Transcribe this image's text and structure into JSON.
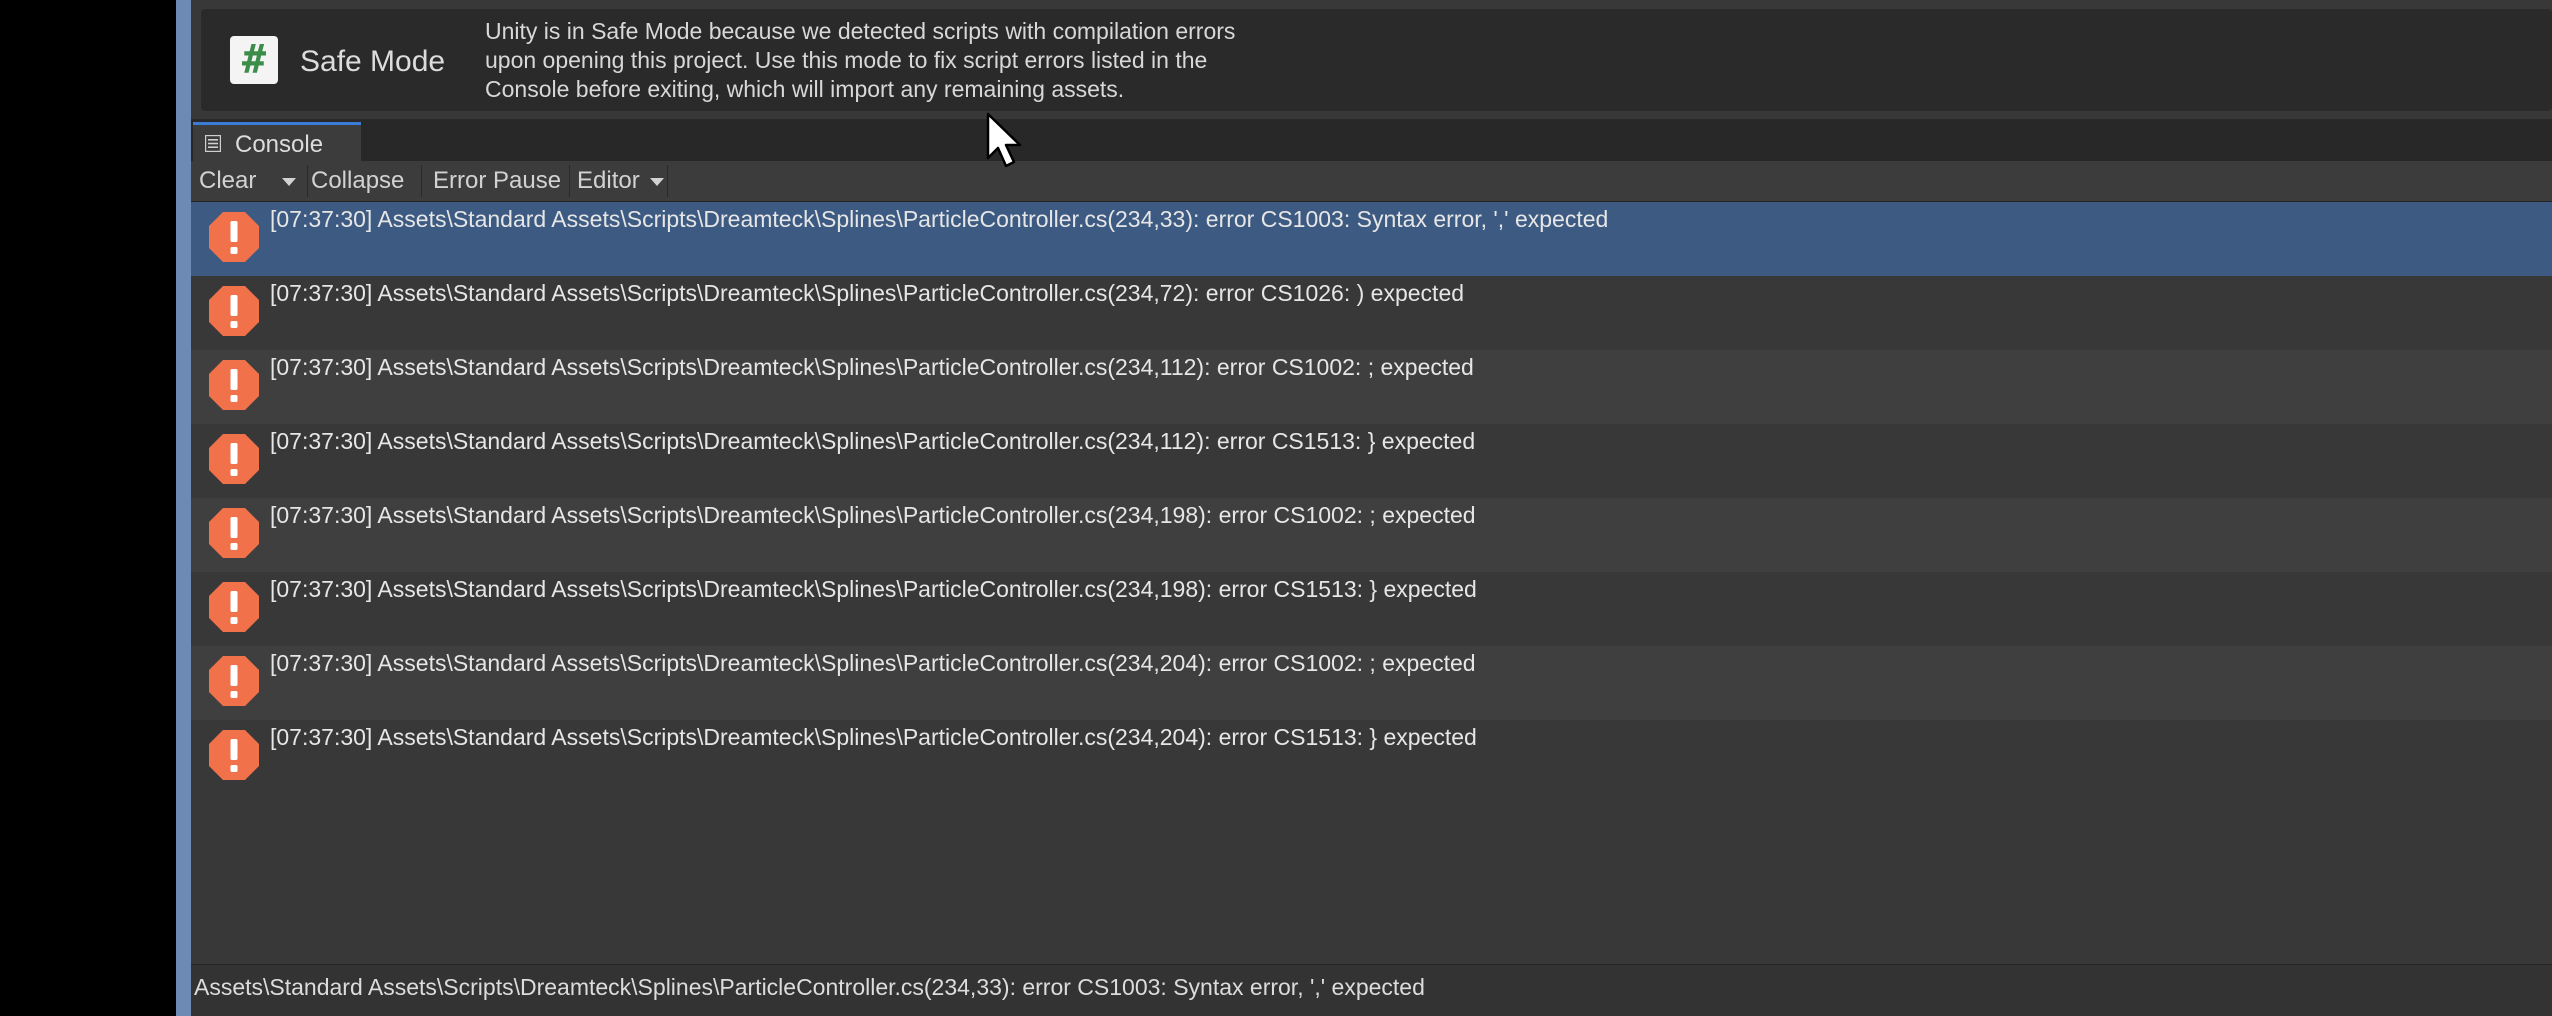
{
  "safe_mode": {
    "icon": "hash-icon",
    "icon_glyph": "#",
    "title": "Safe Mode",
    "message_lines": [
      "Unity is in Safe Mode because we detected scripts with compilation errors",
      "upon opening this project. Use this mode to fix script errors listed in the",
      "Console before exiting, which will import any remaining assets."
    ]
  },
  "tabs": [
    {
      "label": "Console",
      "icon": "console-list-icon",
      "active": true
    }
  ],
  "toolbar": {
    "clear_label": "Clear",
    "collapse_label": "Collapse",
    "error_pause_label": "Error Pause",
    "editor_label": "Editor"
  },
  "logs": [
    {
      "text": "[07:37:30] Assets\\Standard Assets\\Scripts\\Dreamteck\\Splines\\ParticleController.cs(234,33): error CS1003: Syntax error, ',' expected",
      "type": "error",
      "selected": true
    },
    {
      "text": "[07:37:30] Assets\\Standard Assets\\Scripts\\Dreamteck\\Splines\\ParticleController.cs(234,72): error CS1026: ) expected",
      "type": "error",
      "selected": false
    },
    {
      "text": "[07:37:30] Assets\\Standard Assets\\Scripts\\Dreamteck\\Splines\\ParticleController.cs(234,112): error CS1002: ; expected",
      "type": "error",
      "selected": false
    },
    {
      "text": "[07:37:30] Assets\\Standard Assets\\Scripts\\Dreamteck\\Splines\\ParticleController.cs(234,112): error CS1513: } expected",
      "type": "error",
      "selected": false
    },
    {
      "text": "[07:37:30] Assets\\Standard Assets\\Scripts\\Dreamteck\\Splines\\ParticleController.cs(234,198): error CS1002: ; expected",
      "type": "error",
      "selected": false
    },
    {
      "text": "[07:37:30] Assets\\Standard Assets\\Scripts\\Dreamteck\\Splines\\ParticleController.cs(234,198): error CS1513: } expected",
      "type": "error",
      "selected": false
    },
    {
      "text": "[07:37:30] Assets\\Standard Assets\\Scripts\\Dreamteck\\Splines\\ParticleController.cs(234,204): error CS1002: ; expected",
      "type": "error",
      "selected": false
    },
    {
      "text": "[07:37:30] Assets\\Standard Assets\\Scripts\\Dreamteck\\Splines\\ParticleController.cs(234,204): error CS1513: } expected",
      "type": "error",
      "selected": false
    }
  ],
  "status_bar": {
    "text": "Assets\\Standard Assets\\Scripts\\Dreamteck\\Splines\\ParticleController.cs(234,33): error CS1003: Syntax error, ',' expected"
  },
  "colors": {
    "error_icon": "#f0714a",
    "selected_row": "#3d5b82",
    "accent_tab": "#3a7bd5"
  }
}
